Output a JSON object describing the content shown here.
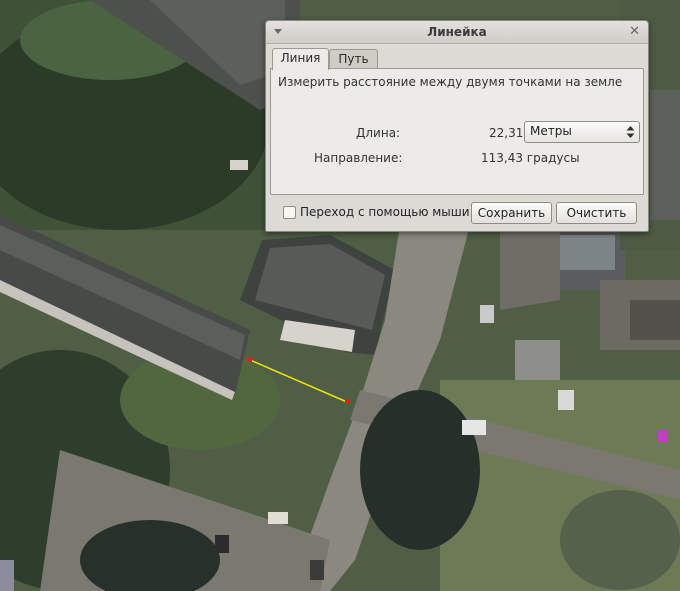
{
  "dialog": {
    "title": "Линейка",
    "tabs": [
      "Линия",
      "Путь"
    ],
    "active_tab": "Линия",
    "description": "Измерить расстояние между двумя точками на земле",
    "length_label": "Длина:",
    "length_value": "22,31",
    "units_value": "Метры",
    "direction_label": "Направление:",
    "direction_value": "113,43 градусы",
    "mouse_nav_label": "Переход с помощью мыши",
    "mouse_nav_checked": false,
    "save_label": "Сохранить",
    "clear_label": "Очистить"
  },
  "measure_line": {
    "color": "#f2e600",
    "endpoint_color": "#e0201c"
  },
  "icons": [
    "menu-arrow-icon",
    "close-icon",
    "spin-arrows-icon"
  ]
}
